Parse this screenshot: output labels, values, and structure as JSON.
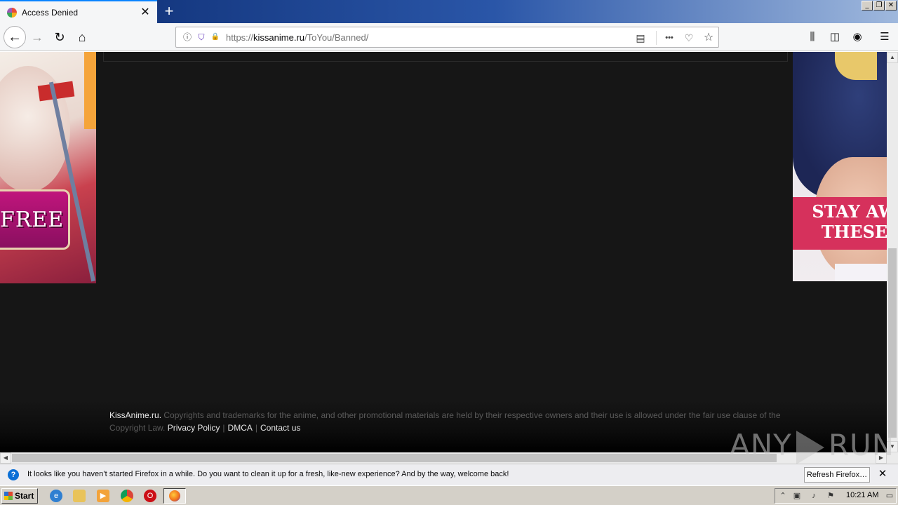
{
  "browser": {
    "tab": {
      "title": "Access Denied",
      "close_glyph": "✕"
    },
    "new_tab_glyph": "+",
    "window_controls": [
      "_",
      "❐",
      "✕"
    ],
    "url": {
      "scheme": "https://",
      "host": "kissanime.ru",
      "path": "/ToYou/Banned/"
    },
    "nav_glyphs": {
      "back": "←",
      "forward": "→",
      "reload": "↻",
      "home": "⌂"
    },
    "toolbar_glyphs": {
      "info": "ⓘ",
      "tracking": "⛉",
      "lock": "🔒",
      "reader": "▤",
      "more": "•••",
      "pocket": "♡",
      "bookmark": "☆",
      "library": "⫼",
      "sidebar": "◫",
      "account": "◉",
      "menu": "☰"
    }
  },
  "page": {
    "ads": {
      "left": {
        "text": "FREE"
      },
      "right": {
        "text_line1": "STAY AW",
        "text_line2": "THESE"
      }
    },
    "footer": {
      "site": "KissAnime.ru.",
      "notice": "Copyrights and trademarks for the anime, and other promotional materials are held by their respective owners and their use is allowed under the fair use clause of the Copyright Law.",
      "links": [
        "Privacy Policy",
        "DMCA",
        "Contact us"
      ],
      "separator": "|"
    }
  },
  "watermark": {
    "left": "ANY",
    "right": "RUN"
  },
  "notification": {
    "message": "It looks like you haven’t started Firefox in a while. Do you want to clean it up for a fresh, like-new experience? And by the way, welcome back!",
    "button": "Refresh Firefox…",
    "close_glyph": "✕",
    "icon_glyph": "?"
  },
  "taskbar": {
    "start_label": "Start",
    "clock": "10:21 AM",
    "apps": [
      "internet-explorer",
      "file-explorer",
      "media-player",
      "chrome",
      "opera",
      "firefox"
    ]
  },
  "colors": {
    "page_bg": "#161616",
    "accent": "#0a84ff",
    "ad_band": "#d6315c",
    "ad_button": "#c0157c"
  }
}
